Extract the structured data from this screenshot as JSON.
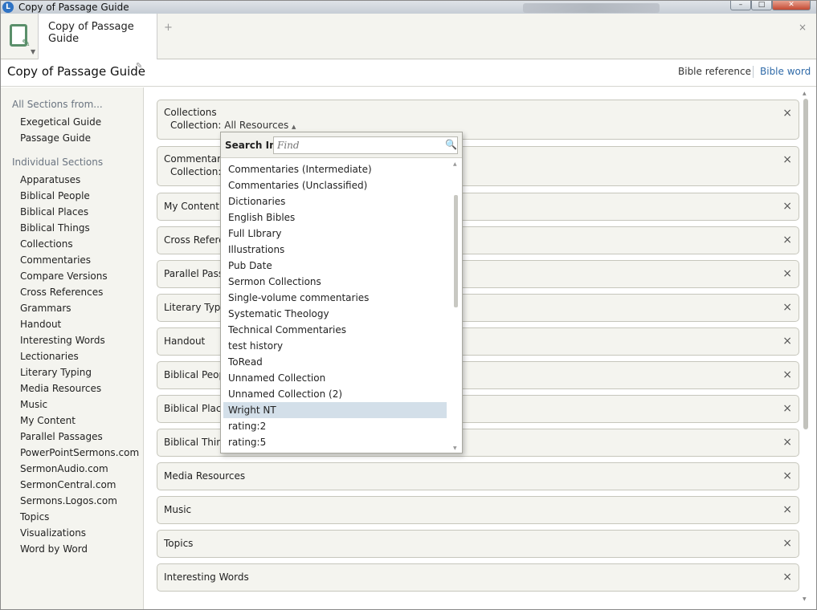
{
  "window": {
    "title": "Copy of Passage Guide",
    "app_icon": "logos-icon",
    "min": "–",
    "max": "□",
    "close": "✕"
  },
  "tabs": {
    "active_label": "Copy of Passage Guide",
    "add": "+",
    "close": "×"
  },
  "header": {
    "title": "Copy of Passage Guide",
    "edit_icon": "✎",
    "bible_reference": "Bible reference",
    "bible_word": "Bible word"
  },
  "sidebar": {
    "all_sections_heading": "All Sections from...",
    "all_sections": [
      "Exegetical Guide",
      "Passage Guide"
    ],
    "individual_heading": "Individual Sections",
    "individual": [
      "Apparatuses",
      "Biblical People",
      "Biblical Places",
      "Biblical Things",
      "Collections",
      "Commentaries",
      "Compare Versions",
      "Cross References",
      "Grammars",
      "Handout",
      "Interesting Words",
      "Lectionaries",
      "Literary Typing",
      "Media Resources",
      "Music",
      "My Content",
      "Parallel Passages",
      "PowerPointSermons.com",
      "SermonAudio.com",
      "SermonCentral.com",
      "Sermons.Logos.com",
      "Topics",
      "Visualizations",
      "Word by Word"
    ]
  },
  "sections": [
    {
      "title": "Collections",
      "sub_label": "Collection:",
      "sub_value": "All Resources",
      "caret": "▲"
    },
    {
      "title": "Commentaries",
      "sub_label": "Collection:"
    },
    {
      "title": "My Content"
    },
    {
      "title": "Cross References"
    },
    {
      "title": "Parallel Passages"
    },
    {
      "title": "Literary Typing"
    },
    {
      "title": "Handout"
    },
    {
      "title": "Biblical People"
    },
    {
      "title": "Biblical Places"
    },
    {
      "title": "Biblical Things"
    },
    {
      "title": "Media Resources"
    },
    {
      "title": "Music"
    },
    {
      "title": "Topics"
    },
    {
      "title": "Interesting Words"
    }
  ],
  "close_glyph": "×",
  "dropdown": {
    "label": "Search In",
    "placeholder": "Find",
    "search_icon": "search-icon",
    "items": [
      "Commentaries (Intermediate)",
      "Commentaries (Unclassified)",
      "Dictionaries",
      "English Bibles",
      "Full LIbrary",
      "Illustrations",
      "Pub Date",
      "Sermon Collections",
      "Single-volume commentaries",
      "Systematic Theology",
      "Technical Commentaries",
      "test history",
      "ToRead",
      "Unnamed Collection",
      "Unnamed Collection (2)",
      "Wright NT",
      "rating:2",
      "rating:5"
    ],
    "selected": "Wright NT"
  },
  "colors": {
    "accent": "#2f6aa8",
    "selected_row": "#d3dfe9",
    "panel_bg": "#f4f4ef"
  }
}
